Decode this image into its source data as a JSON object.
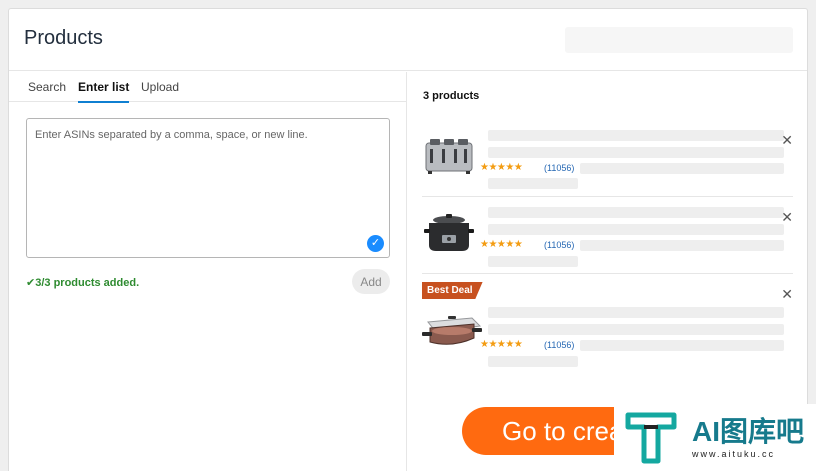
{
  "header": {
    "title": "Products"
  },
  "tabs": [
    {
      "label": "Search",
      "active": false
    },
    {
      "label": "Enter list",
      "active": true
    },
    {
      "label": "Upload",
      "active": false
    }
  ],
  "asin_input": {
    "placeholder": "Enter ASINs separated by a comma, space, or new line.",
    "value": ""
  },
  "status": {
    "check_icon": "check-icon",
    "text": "3/3 products added."
  },
  "add_button": {
    "label": "Add"
  },
  "products_panel": {
    "count_label": "3 products",
    "items": [
      {
        "image": "toaster",
        "rating": 4.5,
        "stars": "★★★★★",
        "reviews": "(11056)",
        "badge": ""
      },
      {
        "image": "slow-cooker",
        "rating": 4.5,
        "stars": "★★★★★",
        "reviews": "(11056)",
        "badge": ""
      },
      {
        "image": "electric-skillet",
        "rating": 4.5,
        "stars": "★★★★★",
        "reviews": "(11056)",
        "badge": "Best Deal"
      }
    ],
    "remove_glyph": "✕"
  },
  "cta": {
    "label": "Go to crea"
  },
  "watermark": {
    "text": "AI图库吧",
    "sub": "www.aituku.cc"
  },
  "colors": {
    "accent": "#ff6a10",
    "link": "#2567b3",
    "success": "#2e8b30",
    "star": "#f39c12",
    "badge": "#c7511f",
    "tab_underline": "#0f7fd1"
  }
}
